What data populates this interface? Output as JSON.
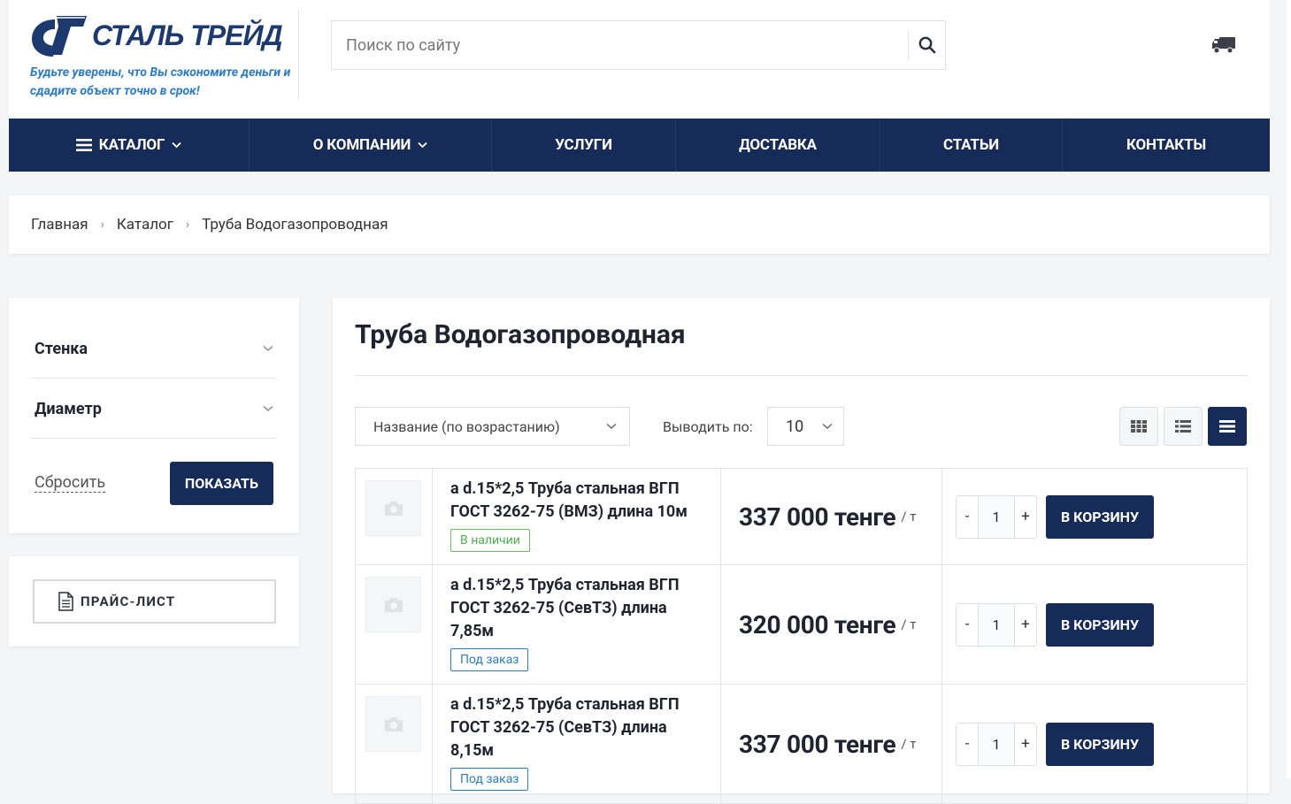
{
  "brand": {
    "name": "СТАЛЬ ТРЕЙД",
    "slogan": "Будьте уверены, что Вы сэкономите деньги и сдадите объект точно в срок!"
  },
  "search": {
    "placeholder": "Поиск по сайту"
  },
  "nav": [
    {
      "label": "КАТАЛОГ"
    },
    {
      "label": "О КОМПАНИИ"
    },
    {
      "label": "УСЛУГИ"
    },
    {
      "label": "ДОСТАВКА"
    },
    {
      "label": "СТАТЬИ"
    },
    {
      "label": "КОНТАКТЫ"
    }
  ],
  "breadcrumbs": [
    "Главная",
    "Каталог",
    "Труба Водогазопроводная"
  ],
  "filters": {
    "items": [
      "Стенка",
      "Диаметр"
    ],
    "reset": "Сбросить",
    "show": "ПОКАЗАТЬ"
  },
  "pricelist": {
    "label": "ПРАЙС-ЛИСТ"
  },
  "main": {
    "title": "Труба Водогазопроводная",
    "sort": "Название (по возрастанию)",
    "perpage_label": "Выводить по:",
    "perpage_value": "10"
  },
  "products": [
    {
      "name": "a d.15*2,5 Труба стальная ВГП ГОСТ 3262-75 (ВМЗ) длина 10м",
      "status": "В наличии",
      "price": "337 000 тенге",
      "unit": "/ т",
      "qty": "1",
      "cart": "В КОРЗИНУ"
    },
    {
      "name": "a d.15*2,5 Труба стальная ВГП ГОСТ 3262-75 (СевТЗ) длина 7,85м",
      "status": "Под заказ",
      "price": "320 000 тенге",
      "unit": "/ т",
      "qty": "1",
      "cart": "В КОРЗИНУ"
    },
    {
      "name": "a d.15*2,5 Труба стальная ВГП ГОСТ 3262-75 (СевТЗ) длина 8,15м",
      "status": "Под заказ",
      "price": "337 000 тенге",
      "unit": "/ т",
      "qty": "1",
      "cart": "В КОРЗИНУ"
    }
  ],
  "qty_controls": {
    "minus": "-",
    "plus": "+"
  },
  "colors": {
    "primary": "#172b58",
    "accent": "#2e7bc4",
    "in_stock": "#4caf50"
  }
}
